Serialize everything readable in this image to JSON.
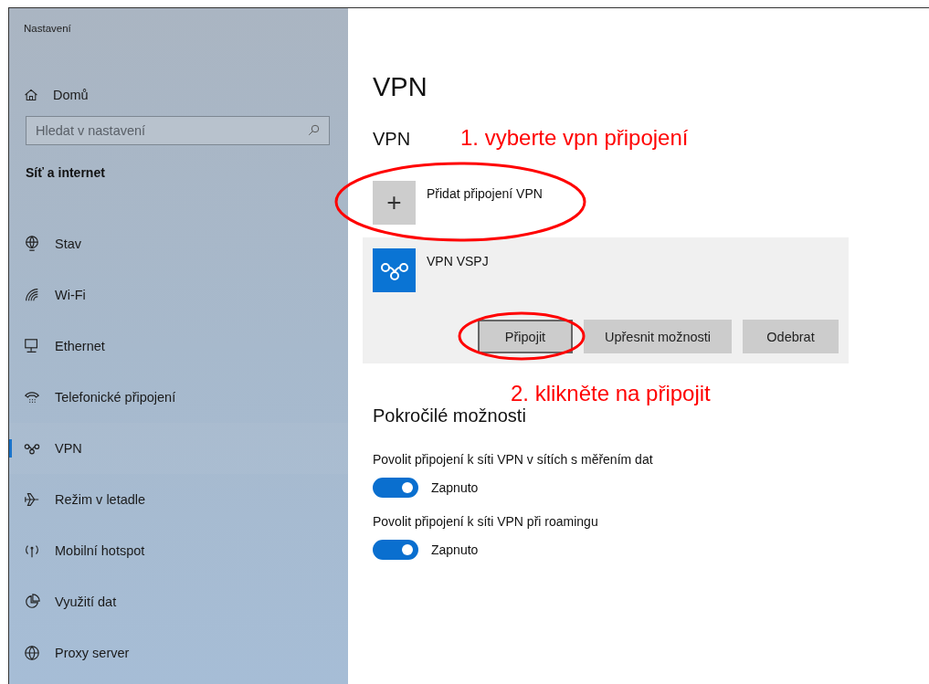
{
  "window": {
    "title": "Nastavení"
  },
  "sidebar": {
    "home": {
      "label": "Domů"
    },
    "search": {
      "placeholder": "Hledat v nastavení"
    },
    "section": "Síť a internet",
    "items": [
      {
        "label": "Stav",
        "selected": false
      },
      {
        "label": "Wi-Fi",
        "selected": false
      },
      {
        "label": "Ethernet",
        "selected": false
      },
      {
        "label": "Telefonické připojení",
        "selected": false
      },
      {
        "label": "VPN",
        "selected": true
      },
      {
        "label": "Režim v letadle",
        "selected": false
      },
      {
        "label": "Mobilní hotspot",
        "selected": false
      },
      {
        "label": "Využití dat",
        "selected": false
      },
      {
        "label": "Proxy server",
        "selected": false
      }
    ]
  },
  "main": {
    "title": "VPN",
    "subtitle": "VPN",
    "add": {
      "icon": "+",
      "label": "Přidat připojení VPN"
    },
    "connection": {
      "name": "VPN VSPJ",
      "buttons": [
        {
          "label": "Připojit",
          "focused": true
        },
        {
          "label": "Upřesnit možnosti",
          "focused": false
        },
        {
          "label": "Odebrat",
          "focused": false
        }
      ]
    },
    "advanced_title": "Pokročilé možnosti",
    "options": [
      {
        "label": "Povolit připojení k síti VPN v sítích s měřením dat",
        "on": true,
        "state": "Zapnuto"
      },
      {
        "label": "Povolit připojení k síti VPN při roamingu",
        "on": true,
        "state": "Zapnuto"
      }
    ]
  },
  "annotations": [
    {
      "kind": "note",
      "text": "1. vyberte vpn připojení",
      "color": "#ff0000"
    },
    {
      "kind": "note",
      "text": "2. klikněte na připojit",
      "color": "#ff0000"
    }
  ]
}
